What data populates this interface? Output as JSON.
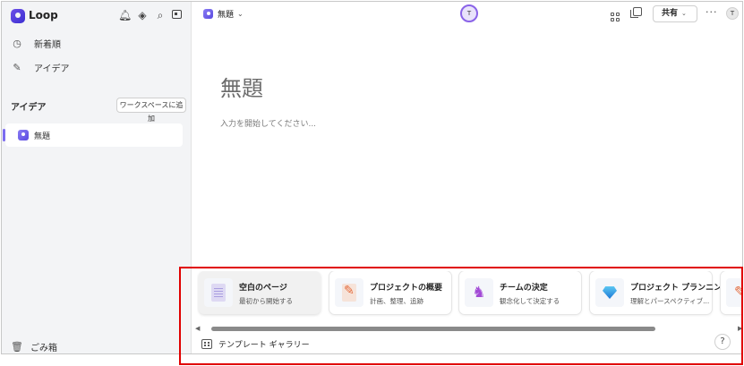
{
  "app": {
    "name": "Loop"
  },
  "sidebar": {
    "icons": [
      "bell-icon",
      "gem-icon",
      "search-icon",
      "panel-icon"
    ],
    "nav": [
      {
        "label": "新着順",
        "icon": "clock-icon"
      },
      {
        "label": "アイデア",
        "icon": "pen-icon"
      }
    ],
    "workspace": {
      "title": "アイデア",
      "add_button": "ワークスペースに追加",
      "pages": [
        {
          "label": "無題"
        }
      ]
    },
    "trash_label": "ごみ箱"
  },
  "topbar": {
    "doc_name": "無題",
    "center_avatar": "T",
    "share_label": "共有",
    "more_label": "···",
    "user_avatar": "T"
  },
  "document": {
    "title": "無題",
    "placeholder": "入力を開始してください..."
  },
  "templates": {
    "cards": [
      {
        "title": "空白のページ",
        "subtitle": "最初から開始する",
        "icon": "blank-page-icon"
      },
      {
        "title": "プロジェクトの概要",
        "subtitle": "計画、整理、追跡",
        "icon": "document-pencil-icon"
      },
      {
        "title": "チームの決定",
        "subtitle": "観念化して決定する",
        "icon": "unicorn-icon"
      },
      {
        "title": "プロジェクト プランニング",
        "subtitle": "理解とパースペクティブ...",
        "icon": "diamond-icon"
      },
      {
        "title": "",
        "subtitle": "",
        "icon": "pencil-icon"
      }
    ],
    "gallery_label": "テンプレート ギャラリー",
    "help_label": "?"
  },
  "colors": {
    "accent": "#7b6cf0",
    "annotation": "#e00000",
    "sidebar_bg": "#f3f4f6"
  }
}
